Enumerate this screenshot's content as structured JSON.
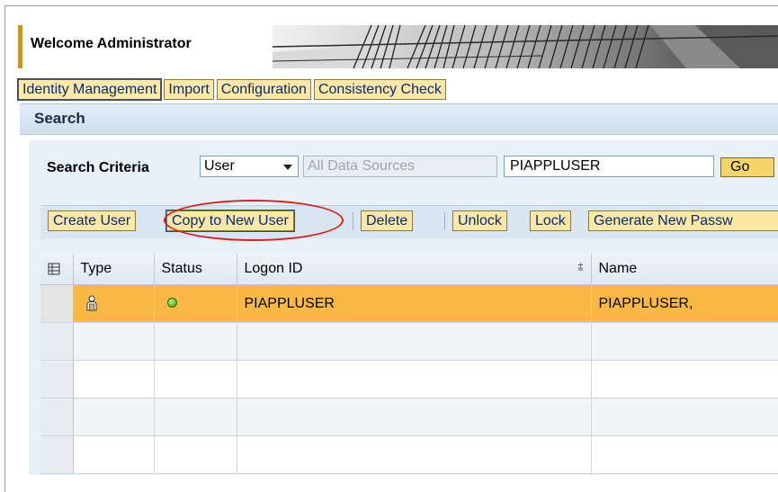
{
  "header": {
    "welcome": "Welcome Administrator"
  },
  "nav": {
    "tabs": [
      {
        "label": "Identity Management",
        "active": true
      },
      {
        "label": "Import"
      },
      {
        "label": "Configuration"
      },
      {
        "label": "Consistency Check"
      }
    ]
  },
  "search": {
    "title": "Search",
    "criteria_label": "Search Criteria",
    "type_select": "User",
    "data_source": "All Data Sources",
    "query": "PIAPPLUSER",
    "go_label": "Go"
  },
  "toolbar": {
    "create_user": "Create User",
    "copy_user": "Copy to New User",
    "delete": "Delete",
    "unlock": "Unlock",
    "lock": "Lock",
    "generate_password": "Generate New Passw"
  },
  "table": {
    "columns": [
      "Type",
      "Status",
      "Logon ID",
      "Name"
    ],
    "rows": [
      {
        "type": "user-icon",
        "status": "green-status-icon",
        "logon_id": "PIAPPLUSER",
        "name": "PIAPPLUSER,",
        "selected": true
      }
    ]
  },
  "colors": {
    "button_bg": "#fbe8a6",
    "selected_row": "#f9b844",
    "highlight_ring": "#d9211a",
    "panel_bg": "#e9f1f8"
  }
}
